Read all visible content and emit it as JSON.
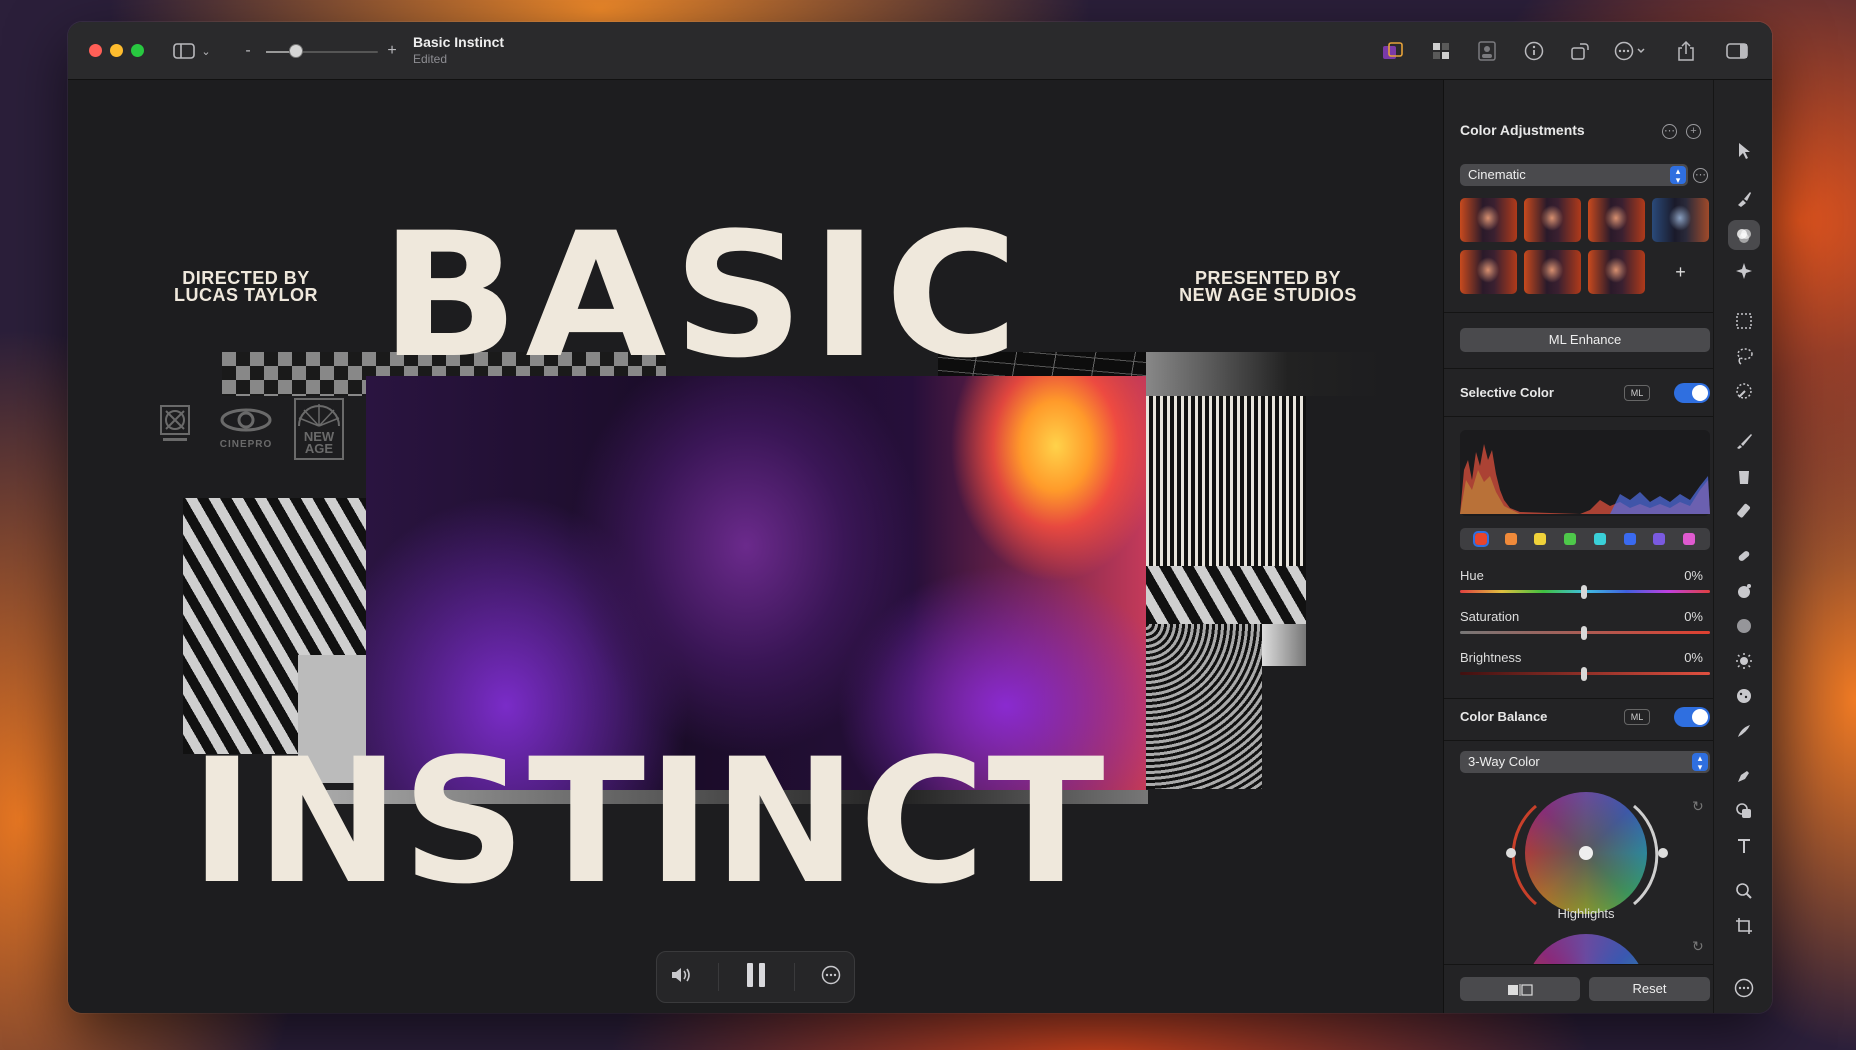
{
  "window": {
    "doc_title": "Basic Instinct",
    "doc_subtitle": "Edited"
  },
  "toolbar": {
    "zoom_minus": "-",
    "zoom_plus": "+",
    "zoom_level": 0.27
  },
  "poster": {
    "title_top": "BASIC",
    "title_bottom": "INSTINCT",
    "credit_left_line1": "DIRECTED BY",
    "credit_left_line2": "LUCAS TAYLOR",
    "credit_right_line1": "PRESENTED BY",
    "credit_right_line2": "NEW AGE STUDIOS",
    "logo_cinepro": "CINEPRO",
    "logo_newage_line1": "NEW",
    "logo_newage_line2": "AGE"
  },
  "panel": {
    "header": "Color Adjustments",
    "preset_select": "Cinematic",
    "add_thumb": "+",
    "ml_enhance": "ML Enhance",
    "selective_color": {
      "title": "Selective Color",
      "ml_badge": "ML",
      "enabled": true,
      "swatches": [
        "#e8452c",
        "#f08a3a",
        "#f0d23a",
        "#4ec84a",
        "#3ad0d8",
        "#3a6af0",
        "#7a5ae0",
        "#e05ad0"
      ],
      "hue_label": "Hue",
      "hue_value": "0%",
      "saturation_label": "Saturation",
      "saturation_value": "0%",
      "brightness_label": "Brightness",
      "brightness_value": "0%"
    },
    "color_balance": {
      "title": "Color Balance",
      "ml_badge": "ML",
      "enabled": true,
      "mode_select": "3-Way Color",
      "wheel_label": "Highlights"
    },
    "footer": {
      "reset": "Reset"
    }
  },
  "colors": {
    "accent": "#2f6fe0",
    "poster_text": "#efe8dc"
  }
}
